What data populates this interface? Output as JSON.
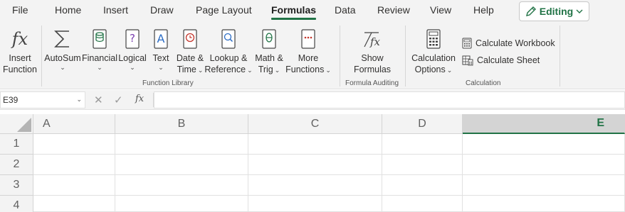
{
  "menu": {
    "tabs": [
      "File",
      "Home",
      "Insert",
      "Draw",
      "Page Layout",
      "Formulas",
      "Data",
      "Review",
      "View",
      "Help"
    ],
    "active_tab": "Formulas",
    "editing_label": "Editing",
    "accent_color": "#217346"
  },
  "ribbon": {
    "insert_function": [
      "Insert",
      "Function"
    ],
    "autosum": "AutoSum",
    "financial": "Financial",
    "logical": "Logical",
    "text": "Text",
    "date_time": [
      "Date &",
      "Time"
    ],
    "lookup_reference": [
      "Lookup &",
      "Reference"
    ],
    "math_trig": [
      "Math &",
      "Trig"
    ],
    "more_functions": [
      "More",
      "Functions"
    ],
    "function_library_label": "Function Library",
    "show_formulas": [
      "Show",
      "Formulas"
    ],
    "formula_auditing_label": "Formula Auditing",
    "calculation_options": [
      "Calculation",
      "Options"
    ],
    "calculate_workbook": "Calculate Workbook",
    "calculate_sheet": "Calculate Sheet",
    "calculation_label": "Calculation"
  },
  "formula_bar": {
    "name_box": "E39",
    "fx": "fx",
    "formula": ""
  },
  "grid": {
    "columns": [
      "A",
      "B",
      "C",
      "D",
      "E"
    ],
    "selected_column": "E",
    "rows": [
      "1",
      "2",
      "3",
      "4"
    ]
  }
}
